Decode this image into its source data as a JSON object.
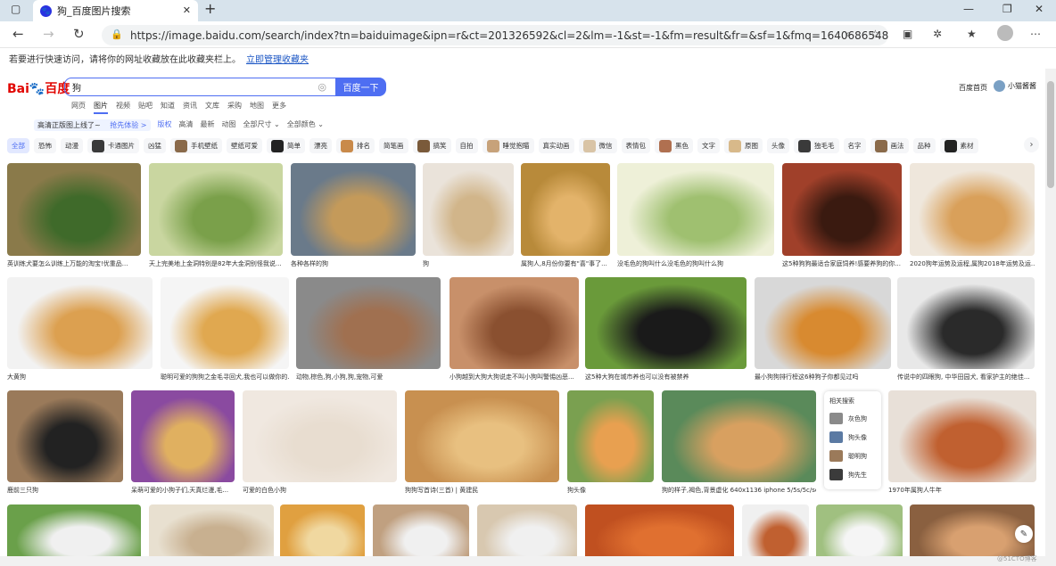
{
  "browser": {
    "tab_title": "狗_百度图片搜索",
    "new_tab": "+",
    "url": "https://image.baidu.com/search/index?tn=baiduimage&ipn=r&ct=201326592&cl=2&lm=-1&st=-1&fm=result&fr=&sf=1&fmq=1640686548670_R&pv=&ic=&nc=...",
    "fav_hint": "若要进行快速访问，请将你的网址收藏放在此收藏夹栏上。",
    "fav_link": "立即管理收藏夹"
  },
  "header": {
    "logo_bai": "Bai",
    "logo_du": "百度",
    "search_value": "狗",
    "search_button": "百度一下",
    "home_link": "百度首页",
    "username": "小猫酱酱"
  },
  "nav_tabs": [
    "网页",
    "图片",
    "视频",
    "贴吧",
    "知道",
    "资讯",
    "文库",
    "采购",
    "地图",
    "更多"
  ],
  "filters": {
    "hd": "高清正版图上线了~",
    "hd_link": "抢先体验 >",
    "items": [
      "版权",
      "高清",
      "最新",
      "动图",
      "全部尺寸 ⌄",
      "全部颜色 ⌄"
    ]
  },
  "tags": [
    "全部",
    "恐怖",
    "动漫",
    "卡通图片",
    "凶猛",
    "手机壁纸",
    "壁纸可爱",
    "简单",
    "漂亮",
    "排名",
    "简笔画",
    "搞笑",
    "自拍",
    "睡觉抱瞄",
    "真实动画",
    "微信",
    "表情包",
    "黑色",
    "文字",
    "原图",
    "头像",
    "独毛毛",
    "名字",
    "画法",
    "品种",
    "素材"
  ],
  "captions_row1": [
    "英训练犬要怎么训练上万能的淘宝!优重品...",
    "天上完美地上金洞特别是82年大金洞别怪我说...",
    "各种各样的狗",
    "狗",
    "属狗人,8月份你要有\"喜\"事了...",
    "没毛色的狗叫什么没毛色的狗叫什么狗",
    "这5种狗狗最适合家庭饲养!感要养狗的你...",
    "2020狗年运势及运程,属狗2018年运势及运..."
  ],
  "captions_row2": [
    "大黄狗",
    "聪明可爱的狗狗之金毛寻回犬,我也可以做你的...",
    "动物,棕色,狗,小狗,狗,宠物,可爱",
    "小狗越到大狗大狗说走不叫小狗叫警惕凶恶...",
    "这5种大狗在城市养也可以没有被禁养",
    "最小狗狗排行榜这6种狗子你都见过吗",
    "传说中的四眼狗, 中华田园犬, 看家护主的绝佳..."
  ],
  "captions_row3": [
    "鹿前三只狗",
    "呆萌可爱的小狗子们,天真烂漫,毛...",
    "可爱的白色小狗",
    "狗狗写首诗(三首) | 黄建民",
    "狗头像",
    "狗的样子,褐色,背景虚化 640x1136 iphone 5/5s/5c/se",
    "1970年属狗人牛年"
  ],
  "related": {
    "title": "相关搜索",
    "items": [
      "灰色狗",
      "狗头像",
      "聪明狗",
      "狗先生"
    ]
  },
  "watermark": "@51CTO博客"
}
